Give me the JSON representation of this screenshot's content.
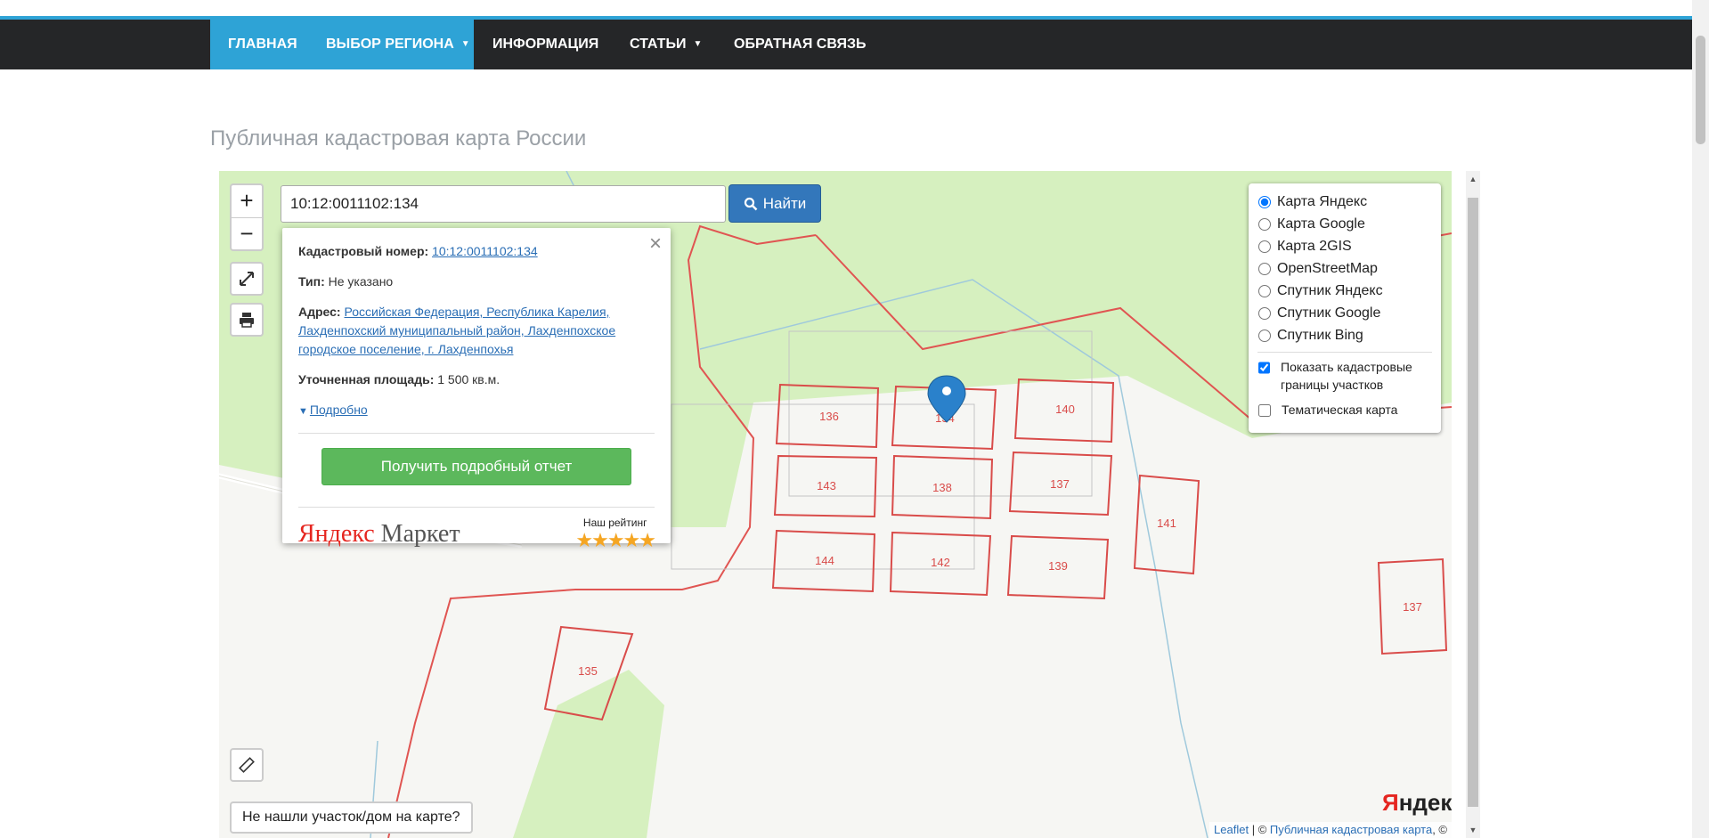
{
  "nav": {
    "items": [
      {
        "label": "ГЛАВНАЯ"
      },
      {
        "label": "ВЫБОР РЕГИОНА"
      },
      {
        "label": "ИНФОРМАЦИЯ"
      },
      {
        "label": "СТАТЬИ"
      },
      {
        "label": "ОБРАТНАЯ СВЯЗЬ"
      }
    ],
    "accent_color": "#2ea3d6",
    "bg_color": "#252628"
  },
  "page_title": "Публичная кадастровая карта России",
  "map": {
    "zoom_in": "+",
    "zoom_out": "−",
    "search": {
      "value": "10:12:0011102:134",
      "button_label": "Найти"
    },
    "popup": {
      "close": "×",
      "cadastral_label": "Кадастровый номер:",
      "cadastral_value": "10:12:0011102:134",
      "type_label": "Тип:",
      "type_value": "Не указано",
      "address_label": "Адрес:",
      "address_value": "Российская Федерация, Республика Карелия, Лахденпохский муниципальный район, Лахденпохское городское поселение, г. Лахденпохья",
      "area_label": "Уточненная площадь:",
      "area_value": "1 500 кв.м.",
      "more_label": "Подробно",
      "report_button": "Получить подробный отчет",
      "market_logo_a": "Яндекс",
      "market_logo_b": "Маркет",
      "rating_label": "Наш рейтинг",
      "rating_stars": "★★★★★"
    },
    "layers": {
      "options": [
        {
          "label": "Карта Яндекс",
          "checked": true
        },
        {
          "label": "Карта Google",
          "checked": false
        },
        {
          "label": "Карта 2GIS",
          "checked": false
        },
        {
          "label": "OpenStreetMap",
          "checked": false
        },
        {
          "label": "Спутник Яндекс",
          "checked": false
        },
        {
          "label": "Спутник Google",
          "checked": false
        },
        {
          "label": "Спутник Bing",
          "checked": false
        }
      ],
      "show_boundaries": "Показать кадастровые границы участков",
      "thematic": "Тематическая карта"
    },
    "parcels": [
      "136",
      "134",
      "140",
      "143",
      "138",
      "137",
      "144",
      "142",
      "139",
      "141",
      "137",
      "135"
    ],
    "not_found": "Не нашли участок/дом на карте?",
    "provider_logo": "Яндекс",
    "attribution": {
      "leaflet": "Leaflet",
      "sep": " | © ",
      "pkk": "Публичная кадастровая карта",
      "tail": ", ©"
    }
  }
}
